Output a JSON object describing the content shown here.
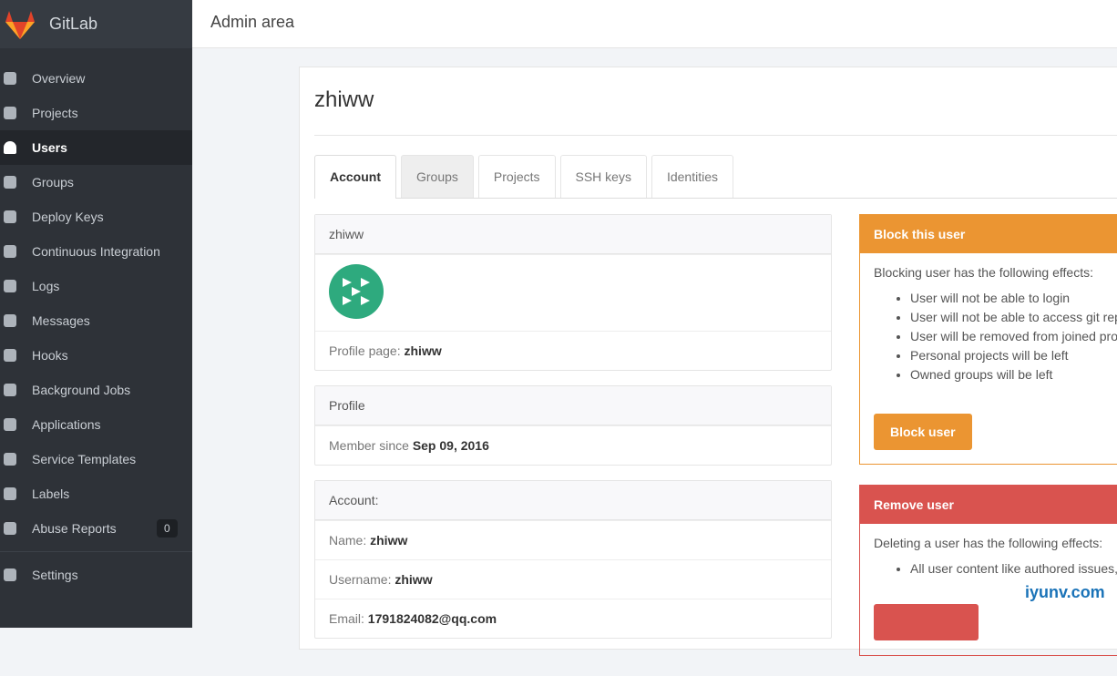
{
  "sidebar": {
    "brand": "GitLab",
    "items": [
      {
        "label": "Overview",
        "icon": "dashboard-icon"
      },
      {
        "label": "Projects",
        "icon": "cube-icon"
      },
      {
        "label": "Users",
        "icon": "user-icon"
      },
      {
        "label": "Groups",
        "icon": "users-icon"
      },
      {
        "label": "Deploy Keys",
        "icon": "key-icon"
      },
      {
        "label": "Continuous Integration",
        "icon": "building-icon"
      },
      {
        "label": "Logs",
        "icon": "file-icon"
      },
      {
        "label": "Messages",
        "icon": "bullhorn-icon"
      },
      {
        "label": "Hooks",
        "icon": "external-link-icon"
      },
      {
        "label": "Background Jobs",
        "icon": "gear-icon"
      },
      {
        "label": "Applications",
        "icon": "cloud-icon"
      },
      {
        "label": "Service Templates",
        "icon": "copy-icon"
      },
      {
        "label": "Labels",
        "icon": "tags-icon"
      },
      {
        "label": "Abuse Reports",
        "icon": "exclamation-icon",
        "badge": "0"
      }
    ],
    "settings": "Settings"
  },
  "header": {
    "title": "Admin area"
  },
  "user": {
    "name": "zhiww"
  },
  "tabs": [
    "Account",
    "Groups",
    "Projects",
    "SSH keys",
    "Identities"
  ],
  "profile_card": {
    "title": "zhiww",
    "profile_label": "Profile page:",
    "profile_value": "zhiww"
  },
  "profile": {
    "title": "Profile",
    "since_label": "Member since",
    "since_value": "Sep 09, 2016"
  },
  "account": {
    "title": "Account:",
    "name_label": "Name:",
    "name": "zhiww",
    "username_label": "Username:",
    "username": "zhiww",
    "email_label": "Email:",
    "email": "1791824082@qq.com"
  },
  "block": {
    "title": "Block this user",
    "intro": "Blocking user has the following effects:",
    "effects": [
      "User will not be able to login",
      "User will not be able to access git rep",
      "User will be removed from joined pro",
      "Personal projects will be left",
      "Owned groups will be left"
    ],
    "button": "Block user",
    "color": "#eb9532"
  },
  "remove": {
    "title": "Remove user",
    "intro": "Deleting a user has the following effects:",
    "effects": [
      "All user content like authored issues,"
    ],
    "color": "#d9534f"
  },
  "watermark": "iyunv.com"
}
